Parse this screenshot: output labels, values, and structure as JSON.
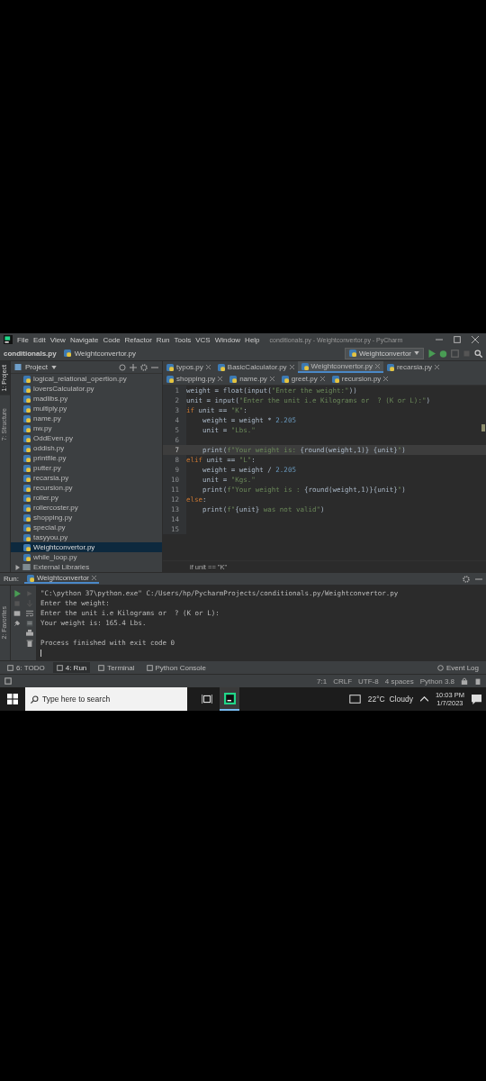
{
  "window": {
    "title": "conditionals.py - Weightconvertor.py - PyCharm"
  },
  "menu": [
    "File",
    "Edit",
    "View",
    "Navigate",
    "Code",
    "Refactor",
    "Run",
    "Tools",
    "VCS",
    "Window",
    "Help"
  ],
  "breadcrumbs": [
    "conditionals.py",
    "Weightconvertor.py"
  ],
  "run_configuration": "Weightconvertor",
  "left_stripe": [
    {
      "label": "1: Project",
      "selected": true
    },
    {
      "label": "7: Structure",
      "selected": false
    }
  ],
  "favorites_tab": {
    "label": "2: Favorites",
    "selected": false
  },
  "project_panel": {
    "title": "Project",
    "items": [
      {
        "name": "logical_relational_opertion.py",
        "selected": false
      },
      {
        "name": "loversCalculator.py",
        "selected": false
      },
      {
        "name": "madlibs.py",
        "selected": false
      },
      {
        "name": "multiply.py",
        "selected": false
      },
      {
        "name": "name.py",
        "selected": false
      },
      {
        "name": "nw.py",
        "selected": false
      },
      {
        "name": "OddEven.py",
        "selected": false
      },
      {
        "name": "oddish.py",
        "selected": false
      },
      {
        "name": "printfile.py",
        "selected": false
      },
      {
        "name": "putter.py",
        "selected": false
      },
      {
        "name": "recarsia.py",
        "selected": false
      },
      {
        "name": "recursion.py",
        "selected": false
      },
      {
        "name": "roller.py",
        "selected": false
      },
      {
        "name": "rollercoster.py",
        "selected": false
      },
      {
        "name": "shopping.py",
        "selected": false
      },
      {
        "name": "special.py",
        "selected": false
      },
      {
        "name": "tasyyou.py",
        "selected": false
      },
      {
        "name": "Weightconvertor.py",
        "selected": true
      },
      {
        "name": "while_loop.py",
        "selected": false
      }
    ],
    "external_libraries": {
      "label": "External Libraries",
      "expanded": false
    }
  },
  "editor_tabs": [
    {
      "label": "typos.py",
      "selected": false
    },
    {
      "label": "BasicCalculator.py",
      "selected": false
    },
    {
      "label": "Weightconvertor.py",
      "selected": true
    },
    {
      "label": "recarsia.py",
      "selected": false
    },
    {
      "label": "shopping.py",
      "selected": false
    },
    {
      "label": "name.py",
      "selected": false
    },
    {
      "label": "greet.py",
      "selected": false
    },
    {
      "label": "recursion.py",
      "selected": false
    }
  ],
  "code_lines": [
    {
      "number": "1",
      "current": false,
      "tokens": [
        {
          "kind": "plain",
          "text": "weight = float(input("
        },
        {
          "kind": "string",
          "text": "\"Enter the weight:\""
        },
        {
          "kind": "plain",
          "text": "))"
        }
      ]
    },
    {
      "number": "2",
      "current": false,
      "tokens": [
        {
          "kind": "plain",
          "text": "unit = input("
        },
        {
          "kind": "string",
          "text": "\"Enter the unit i.e Kilograms or  ? (K or L):\""
        },
        {
          "kind": "plain",
          "text": ")"
        }
      ]
    },
    {
      "number": "3",
      "current": false,
      "tokens": [
        {
          "kind": "keyword",
          "text": "if "
        },
        {
          "kind": "plain",
          "text": "unit == "
        },
        {
          "kind": "string",
          "text": "\"K\""
        },
        {
          "kind": "plain",
          "text": ":"
        }
      ]
    },
    {
      "number": "4",
      "current": false,
      "tokens": [
        {
          "kind": "plain",
          "text": "    weight = weight * "
        },
        {
          "kind": "number",
          "text": "2.205"
        }
      ]
    },
    {
      "number": "5",
      "current": false,
      "tokens": [
        {
          "kind": "plain",
          "text": "    unit = "
        },
        {
          "kind": "string",
          "text": "\"Lbs.\""
        }
      ]
    },
    {
      "number": "6",
      "current": false
    },
    {
      "number": "7",
      "current": true,
      "tokens": [
        {
          "kind": "plain",
          "text": "    print("
        },
        {
          "kind": "string",
          "text": "f\"Your weight is: "
        },
        {
          "kind": "plain",
          "text": "{round(weight,1)} {unit}"
        },
        {
          "kind": "string",
          "text": "\""
        },
        {
          "kind": "plain",
          "text": ")"
        }
      ]
    },
    {
      "number": "8",
      "current": false,
      "tokens": [
        {
          "kind": "keyword",
          "text": "elif "
        },
        {
          "kind": "plain",
          "text": "unit == "
        },
        {
          "kind": "string",
          "text": "\"L\""
        },
        {
          "kind": "plain",
          "text": ":"
        }
      ]
    },
    {
      "number": "9",
      "current": false,
      "tokens": [
        {
          "kind": "plain",
          "text": "    weight = weight / "
        },
        {
          "kind": "number",
          "text": "2.205"
        }
      ]
    },
    {
      "number": "10",
      "current": false,
      "tokens": [
        {
          "kind": "plain",
          "text": "    unit = "
        },
        {
          "kind": "string",
          "text": "\"Kgs.\""
        }
      ]
    },
    {
      "number": "11",
      "current": false,
      "tokens": [
        {
          "kind": "plain",
          "text": "    print("
        },
        {
          "kind": "string",
          "text": "f\"Your weight is : "
        },
        {
          "kind": "plain",
          "text": "{round(weight,1)}{unit}"
        },
        {
          "kind": "string",
          "text": "\""
        },
        {
          "kind": "plain",
          "text": ")"
        }
      ]
    },
    {
      "number": "12",
      "current": false,
      "tokens": [
        {
          "kind": "keyword",
          "text": "else"
        },
        {
          "kind": "plain",
          "text": ":"
        }
      ]
    },
    {
      "number": "13",
      "current": false,
      "tokens": [
        {
          "kind": "plain",
          "text": "    print("
        },
        {
          "kind": "string",
          "text": "f\""
        },
        {
          "kind": "plain",
          "text": "{unit}"
        },
        {
          "kind": "string",
          "text": " was not valid\""
        },
        {
          "kind": "plain",
          "text": ")"
        }
      ]
    },
    {
      "number": "14",
      "current": false
    },
    {
      "number": "15",
      "current": false
    }
  ],
  "editor_breadcrumb": "if unit == \"K\"",
  "run_panel": {
    "label": "Run:",
    "tab": "Weightconvertor",
    "output": [
      "\"C:\\python 37\\python.exe\" C:/Users/hp/PycharmProjects/conditionals.py/Weightconvertor.py",
      "Enter the weight:",
      "Enter the unit i.e Kilograms or  ? (K or L):",
      "Your weight is: 165.4 Lbs."
    ],
    "exit_message": "Process finished with exit code 0"
  },
  "tool_tabs": [
    {
      "label": "6: TODO",
      "selected": false
    },
    {
      "label": "4: Run",
      "selected": true
    },
    {
      "label": "Terminal",
      "selected": false
    },
    {
      "label": "Python Console",
      "selected": false
    }
  ],
  "event_log": "Event Log",
  "status_bar": [
    "7:1",
    "CRLF",
    "UTF-8",
    "4 spaces",
    "Python 3.8"
  ],
  "taskbar": {
    "search": {
      "placeholder": "Type here to search"
    },
    "weather": "22°C  Cloudy",
    "time": "10:03 PM",
    "date": "1/7/2023"
  }
}
